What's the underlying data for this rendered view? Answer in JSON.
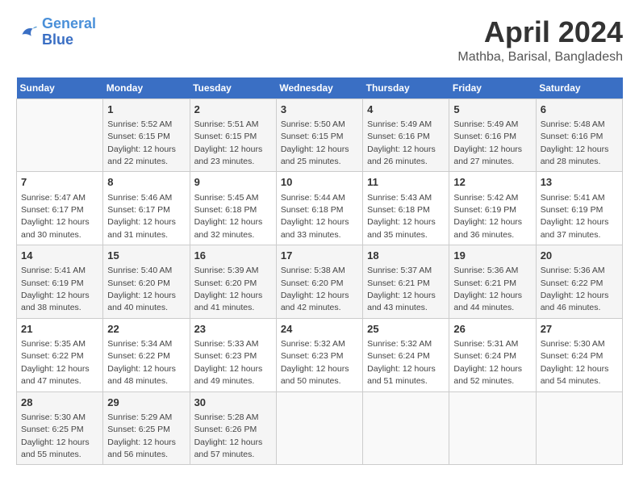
{
  "logo": {
    "line1": "General",
    "line2": "Blue"
  },
  "title": "April 2024",
  "location": "Mathba, Barisal, Bangladesh",
  "headers": [
    "Sunday",
    "Monday",
    "Tuesday",
    "Wednesday",
    "Thursday",
    "Friday",
    "Saturday"
  ],
  "weeks": [
    [
      {
        "day": "",
        "info": ""
      },
      {
        "day": "1",
        "info": "Sunrise: 5:52 AM\nSunset: 6:15 PM\nDaylight: 12 hours\nand 22 minutes."
      },
      {
        "day": "2",
        "info": "Sunrise: 5:51 AM\nSunset: 6:15 PM\nDaylight: 12 hours\nand 23 minutes."
      },
      {
        "day": "3",
        "info": "Sunrise: 5:50 AM\nSunset: 6:15 PM\nDaylight: 12 hours\nand 25 minutes."
      },
      {
        "day": "4",
        "info": "Sunrise: 5:49 AM\nSunset: 6:16 PM\nDaylight: 12 hours\nand 26 minutes."
      },
      {
        "day": "5",
        "info": "Sunrise: 5:49 AM\nSunset: 6:16 PM\nDaylight: 12 hours\nand 27 minutes."
      },
      {
        "day": "6",
        "info": "Sunrise: 5:48 AM\nSunset: 6:16 PM\nDaylight: 12 hours\nand 28 minutes."
      }
    ],
    [
      {
        "day": "7",
        "info": "Sunrise: 5:47 AM\nSunset: 6:17 PM\nDaylight: 12 hours\nand 30 minutes."
      },
      {
        "day": "8",
        "info": "Sunrise: 5:46 AM\nSunset: 6:17 PM\nDaylight: 12 hours\nand 31 minutes."
      },
      {
        "day": "9",
        "info": "Sunrise: 5:45 AM\nSunset: 6:18 PM\nDaylight: 12 hours\nand 32 minutes."
      },
      {
        "day": "10",
        "info": "Sunrise: 5:44 AM\nSunset: 6:18 PM\nDaylight: 12 hours\nand 33 minutes."
      },
      {
        "day": "11",
        "info": "Sunrise: 5:43 AM\nSunset: 6:18 PM\nDaylight: 12 hours\nand 35 minutes."
      },
      {
        "day": "12",
        "info": "Sunrise: 5:42 AM\nSunset: 6:19 PM\nDaylight: 12 hours\nand 36 minutes."
      },
      {
        "day": "13",
        "info": "Sunrise: 5:41 AM\nSunset: 6:19 PM\nDaylight: 12 hours\nand 37 minutes."
      }
    ],
    [
      {
        "day": "14",
        "info": "Sunrise: 5:41 AM\nSunset: 6:19 PM\nDaylight: 12 hours\nand 38 minutes."
      },
      {
        "day": "15",
        "info": "Sunrise: 5:40 AM\nSunset: 6:20 PM\nDaylight: 12 hours\nand 40 minutes."
      },
      {
        "day": "16",
        "info": "Sunrise: 5:39 AM\nSunset: 6:20 PM\nDaylight: 12 hours\nand 41 minutes."
      },
      {
        "day": "17",
        "info": "Sunrise: 5:38 AM\nSunset: 6:20 PM\nDaylight: 12 hours\nand 42 minutes."
      },
      {
        "day": "18",
        "info": "Sunrise: 5:37 AM\nSunset: 6:21 PM\nDaylight: 12 hours\nand 43 minutes."
      },
      {
        "day": "19",
        "info": "Sunrise: 5:36 AM\nSunset: 6:21 PM\nDaylight: 12 hours\nand 44 minutes."
      },
      {
        "day": "20",
        "info": "Sunrise: 5:36 AM\nSunset: 6:22 PM\nDaylight: 12 hours\nand 46 minutes."
      }
    ],
    [
      {
        "day": "21",
        "info": "Sunrise: 5:35 AM\nSunset: 6:22 PM\nDaylight: 12 hours\nand 47 minutes."
      },
      {
        "day": "22",
        "info": "Sunrise: 5:34 AM\nSunset: 6:22 PM\nDaylight: 12 hours\nand 48 minutes."
      },
      {
        "day": "23",
        "info": "Sunrise: 5:33 AM\nSunset: 6:23 PM\nDaylight: 12 hours\nand 49 minutes."
      },
      {
        "day": "24",
        "info": "Sunrise: 5:32 AM\nSunset: 6:23 PM\nDaylight: 12 hours\nand 50 minutes."
      },
      {
        "day": "25",
        "info": "Sunrise: 5:32 AM\nSunset: 6:24 PM\nDaylight: 12 hours\nand 51 minutes."
      },
      {
        "day": "26",
        "info": "Sunrise: 5:31 AM\nSunset: 6:24 PM\nDaylight: 12 hours\nand 52 minutes."
      },
      {
        "day": "27",
        "info": "Sunrise: 5:30 AM\nSunset: 6:24 PM\nDaylight: 12 hours\nand 54 minutes."
      }
    ],
    [
      {
        "day": "28",
        "info": "Sunrise: 5:30 AM\nSunset: 6:25 PM\nDaylight: 12 hours\nand 55 minutes."
      },
      {
        "day": "29",
        "info": "Sunrise: 5:29 AM\nSunset: 6:25 PM\nDaylight: 12 hours\nand 56 minutes."
      },
      {
        "day": "30",
        "info": "Sunrise: 5:28 AM\nSunset: 6:26 PM\nDaylight: 12 hours\nand 57 minutes."
      },
      {
        "day": "",
        "info": ""
      },
      {
        "day": "",
        "info": ""
      },
      {
        "day": "",
        "info": ""
      },
      {
        "day": "",
        "info": ""
      }
    ]
  ]
}
